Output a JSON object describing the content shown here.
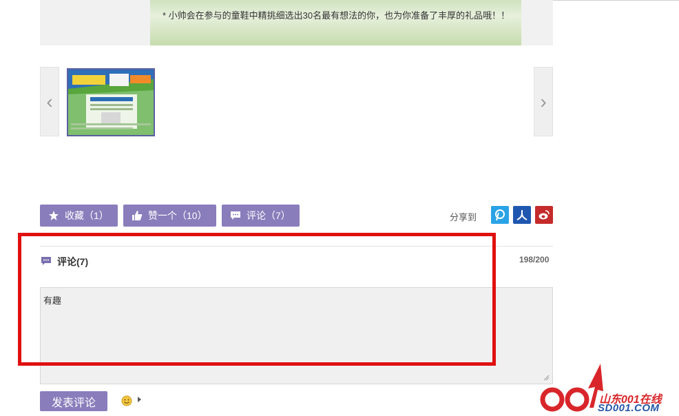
{
  "banner": {
    "text": "* 小帅会在参与的童鞋中精挑细选出30名最有想法的你，也为你准备了丰厚的礼品哦！！"
  },
  "carousel": {
    "prev_glyph": "‹",
    "next_glyph": "›"
  },
  "actions": {
    "favorite_label": "收藏（1）",
    "like_label": "赞一个（10）",
    "comment_label": "评论（7）"
  },
  "share": {
    "label": "分享到",
    "services": [
      {
        "icon": "pinterest-like-icon",
        "color": "#2aa3e6"
      },
      {
        "icon": "renren-icon",
        "color": "#1f57b0"
      },
      {
        "icon": "weibo-icon",
        "color": "#c52b2b"
      }
    ]
  },
  "comments": {
    "title": "评论(7)",
    "counter": "198/200",
    "value": "有趣",
    "post_label": "发表评论"
  },
  "watermark": {
    "cn": "山东001在线",
    "en": "SD001.COM"
  },
  "colors": {
    "accent": "#8a7dbb",
    "highlight": "#e01010"
  }
}
